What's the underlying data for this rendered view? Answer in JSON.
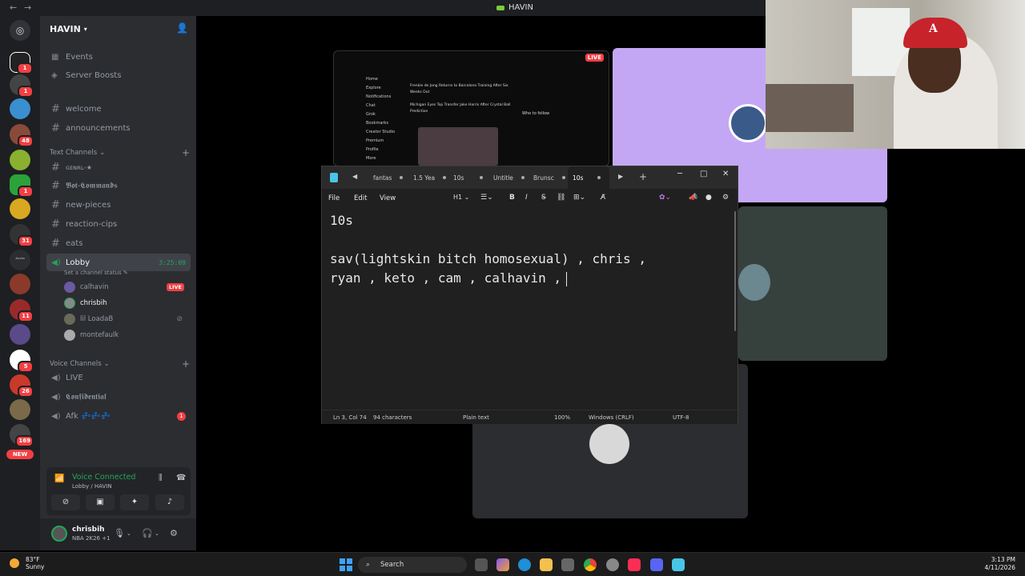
{
  "window": {
    "title": "HAVIN"
  },
  "rail": {
    "badges": [
      "1",
      "1",
      "",
      "",
      "48",
      "",
      "1",
      "",
      "",
      "31",
      "",
      "",
      "11",
      "",
      "5",
      "26",
      "",
      "169"
    ],
    "new_label": "NEW"
  },
  "server": {
    "name": "HAVIN",
    "top_items": [
      {
        "label": "Events"
      },
      {
        "label": "Server Boosts"
      }
    ],
    "channels_top": [
      "welcome",
      "announcements"
    ],
    "text_category": "Text Channels",
    "text_channels": [
      "ɢᴇɴʀʟ-★",
      "𝕭𝖔𝖙-𝕮𝖔𝖒𝖒𝖆𝖓𝖉𝖘",
      "new-pieces",
      "reaction-cips",
      "eats"
    ],
    "lobby": {
      "name": "Lobby",
      "timer": "3:25:09",
      "status": "Set a channel status"
    },
    "voice_users": [
      {
        "name": "calhavin",
        "live": "LIVE"
      },
      {
        "name": "chrisbih"
      },
      {
        "name": "lil LoadaB"
      },
      {
        "name": "montefaulk"
      }
    ],
    "voice_category": "Voice Channels",
    "voice_channels": [
      "LIVE",
      "𝕮𝖔𝖓𝖋𝖎𝖉𝖊𝖓𝖙𝖎𝖆𝖑",
      "Afk 💤💤💤"
    ],
    "afk_unread": "1"
  },
  "voice_panel": {
    "title": "Voice Connected",
    "sub": "Lobby / HAVIN"
  },
  "user": {
    "name": "chrisbih",
    "status": "NBA 2K26 +1"
  },
  "stream": {
    "live": "LIVE",
    "nav": [
      "Home",
      "Explore",
      "Notifications",
      "Chat",
      "Grok",
      "Bookmarks",
      "Creator Studio",
      "Premium",
      "Profile",
      "More"
    ],
    "feed": [
      "Frenkie de Jong Returns to Barcelona Training After Six Weeks Out",
      "Michigan Eyes Top Transfer Jake Harris After Crystal Ball Prediction",
      "Who to follow"
    ]
  },
  "notepad": {
    "tabs": [
      "fantas",
      "1.5 Yea",
      "10s",
      "Untitle",
      "Brunsc",
      "10s"
    ],
    "menu": [
      "File",
      "Edit",
      "View"
    ],
    "heading_btn": "H1",
    "lines": [
      "10s",
      "sav(lightskin bitch homosexual) , chris ,",
      "ryan , keto , cam , calhavin ,"
    ],
    "status": {
      "position": "Ln 3, Col 74",
      "chars": "94 characters",
      "format": "Plain text",
      "zoom": "100%",
      "eol": "Windows (CRLF)",
      "encoding": "UTF-8"
    }
  },
  "taskbar": {
    "weather_temp": "83°F",
    "weather_desc": "Sunny",
    "search": "Search",
    "time": "3:13 PM",
    "date": "4/11/2026"
  },
  "colors": {
    "accent_green": "#23a55a",
    "badge_red": "#f23f43",
    "notepad_accent": "#48c6e8"
  }
}
